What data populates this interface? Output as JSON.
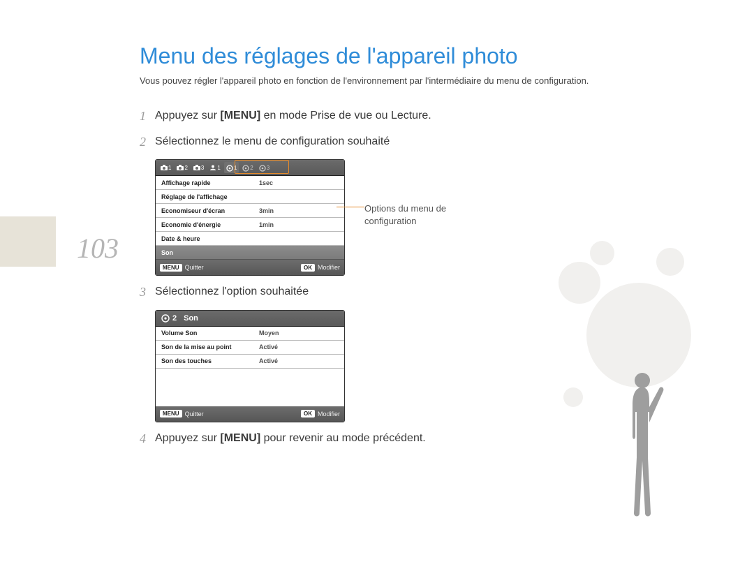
{
  "title": "Menu des réglages de l'appareil photo",
  "subtitle": "Vous pouvez régler l'appareil photo en fonction de l'environnement par l'intermédiaire du menu de configuration.",
  "page_number": "103",
  "steps": {
    "s1": {
      "num": "1",
      "text_pre": "Appuyez sur ",
      "bold": "[MENU]",
      "text_post": " en mode Prise de vue ou Lecture."
    },
    "s2": {
      "num": "2",
      "text": "Sélectionnez le menu de configuration souhaité"
    },
    "s3": {
      "num": "3",
      "text": "Sélectionnez l'option souhaitée"
    },
    "s4": {
      "num": "4",
      "text_pre": "Appuyez sur ",
      "bold": "[MENU]",
      "text_post": " pour revenir au mode précédent."
    }
  },
  "callout": "Options du menu de configuration",
  "screen1": {
    "tabs": [
      "1",
      "2",
      "3",
      "1",
      "1",
      "2",
      "3"
    ],
    "highlight_group": [
      "1",
      "2",
      "3"
    ],
    "rows": [
      {
        "label": "Affichage rapide",
        "value": "1sec"
      },
      {
        "label": "Réglage de l'affichage",
        "value": ""
      },
      {
        "label": "Economiseur d'écran",
        "value": "3min"
      },
      {
        "label": "Economie d'énergie",
        "value": "1min"
      },
      {
        "label": "Date & heure",
        "value": ""
      },
      {
        "label": "Son",
        "value": "",
        "selected": true
      }
    ],
    "footer": {
      "menu_btn": "MENU",
      "menu_label": "Quitter",
      "ok_btn": "OK",
      "ok_label": "Modifier"
    }
  },
  "screen2": {
    "header_num": "2",
    "header_title": "Son",
    "rows": [
      {
        "label": "Volume Son",
        "value": "Moyen"
      },
      {
        "label": "Son de la mise au point",
        "value": "Activé"
      },
      {
        "label": "Son des touches",
        "value": "Activé"
      }
    ],
    "footer": {
      "menu_btn": "MENU",
      "menu_label": "Quitter",
      "ok_btn": "OK",
      "ok_label": "Modifier"
    }
  }
}
